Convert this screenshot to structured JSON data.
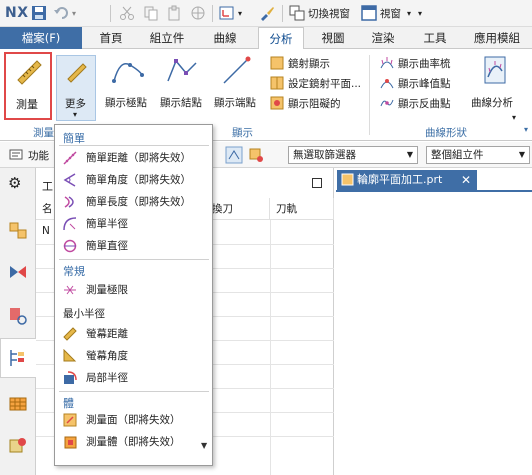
{
  "app": {
    "logo": "NX"
  },
  "titlebar": {
    "switch_window": "切換視窗",
    "window_menu": "視窗"
  },
  "menu": {
    "file": "檔案(F)",
    "tabs": [
      "首頁",
      "組立件",
      "曲線",
      "分析",
      "視圖",
      "渲染",
      "工具",
      "應用模組"
    ],
    "active_tab": "分析"
  },
  "ribbon": {
    "measure": "測量",
    "more": "更多",
    "show_extreme_point": "顯示極點",
    "show_knot_point": "顯示結點",
    "show_end_point": "顯示端點",
    "mirror_display": "鏡射顯示",
    "set_mirror_plane": "設定鏡射平面...",
    "show_blocking": "顯示阻礙的",
    "show_curvature_comb": "顯示曲率梳",
    "show_peak_point": "顯示峰值點",
    "show_inflection": "顯示反曲點",
    "curve_analysis": "曲線分析",
    "group_measure": "測量",
    "group_display": "顯示",
    "group_curve_shape": "曲線形狀"
  },
  "toolbar2": {
    "function": "功能",
    "selection_filter": "無選取篩選器",
    "assembly_scope": "整個組立件"
  },
  "navigator": {
    "title_short": "工",
    "col_name": "名",
    "col_tool_change": "換刀",
    "col_tool_path": "刀軌",
    "row_initial": "N"
  },
  "graphics": {
    "tab_title": "輪廓平面加工.prt"
  },
  "dropdown": {
    "section_simple": "簡單",
    "simple_distance": "簡單距離（即將失效）",
    "simple_angle": "簡單角度（即將失效）",
    "simple_length": "簡單長度（即將失效）",
    "simple_radius": "簡單半徑",
    "simple_diameter": "簡單直徑",
    "section_regular": "常規",
    "measure_limit": "測量極限",
    "min_radius": "最小半徑",
    "screen_distance": "螢幕距離",
    "screen_angle": "螢幕角度",
    "local_radius": "局部半徑",
    "section_body": "體",
    "measure_face": "測量面（即將失效）",
    "measure_body": "測量體（即將失效）"
  },
  "colors": {
    "accent_blue": "#3f6ea6",
    "section_blue": "#3a6ea8",
    "highlight_red": "#e04848"
  }
}
